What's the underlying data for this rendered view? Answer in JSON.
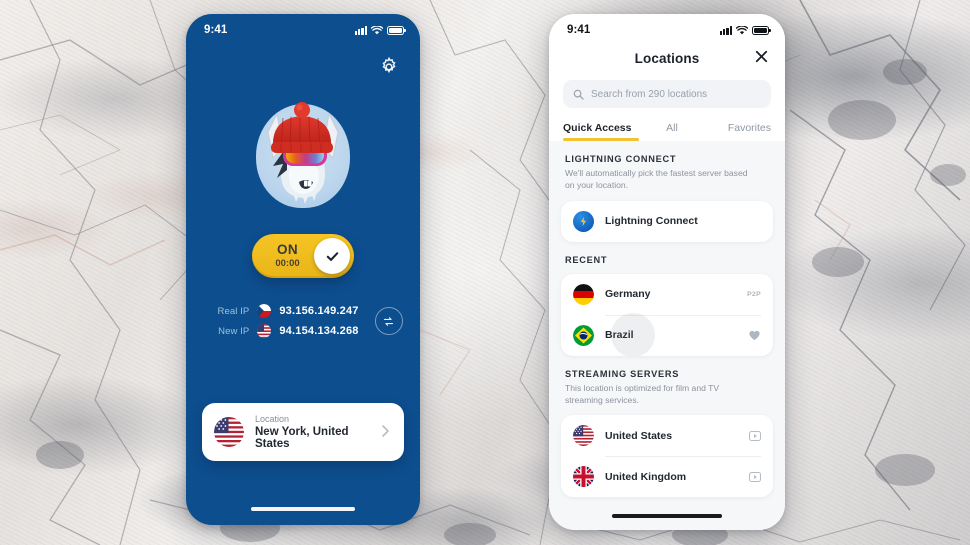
{
  "background": {
    "name": "marble-stone-texture",
    "base_color": "#e4e0dd"
  },
  "left_phone": {
    "accent_blue": "#0d4e8f",
    "statusbar": {
      "time": "9:41",
      "icons": [
        "cellular-signal-icon",
        "wifi-icon",
        "battery-icon"
      ]
    },
    "settings_button": "gear-icon",
    "mascot": "llama-mascot-red-beanie-goggles",
    "toggle": {
      "state_label": "ON",
      "timer": "00:00",
      "knob_icon": "check-icon",
      "color": "#efbb1e"
    },
    "ip_info": {
      "real_label": "Real IP",
      "real_value": "93.156.149.247",
      "real_flag": "czech-republic-flag",
      "new_label": "New IP",
      "new_value": "94.154.134.268",
      "new_flag": "united-states-flag",
      "refresh_icon": "swap-refresh-icon"
    },
    "location_card": {
      "flag": "united-states-flag",
      "label": "Location",
      "value": "New York, United States",
      "chevron": "chevron-right-icon"
    }
  },
  "right_phone": {
    "statusbar": {
      "time": "9:41",
      "icons": [
        "cellular-signal-icon",
        "wifi-icon",
        "battery-icon"
      ]
    },
    "header": {
      "title": "Locations",
      "close_icon": "close-icon"
    },
    "search": {
      "icon": "search-icon",
      "value": "",
      "placeholder": "Search from 290 locations"
    },
    "tabs": [
      {
        "label": "Quick Access",
        "active": true
      },
      {
        "label": "All",
        "active": false
      },
      {
        "label": "Favorites",
        "active": false
      }
    ],
    "accent_yellow": "#f2c230",
    "sections": [
      {
        "title": "LIGHTNING CONNECT",
        "description": "We'll automatically pick the fastest server based on your location.",
        "rows": [
          {
            "label": "Lightning Connect",
            "icon": "lightning-bolt-icon",
            "trailing": "none"
          }
        ]
      },
      {
        "title": "RECENT",
        "description": "",
        "rows": [
          {
            "label": "Germany",
            "icon": "germany-flag",
            "trailing": "P2P"
          },
          {
            "label": "Brazil",
            "icon": "brazil-flag",
            "trailing": "heart-icon",
            "pressed": true
          }
        ]
      },
      {
        "title": "STREAMING SERVERS",
        "description": "This location is optimized for film and TV streaming services.",
        "rows": [
          {
            "label": "United States",
            "icon": "united-states-flag",
            "trailing": "video-icon"
          },
          {
            "label": "United Kingdom",
            "icon": "united-kingdom-flag",
            "trailing": "video-icon"
          }
        ]
      }
    ]
  }
}
